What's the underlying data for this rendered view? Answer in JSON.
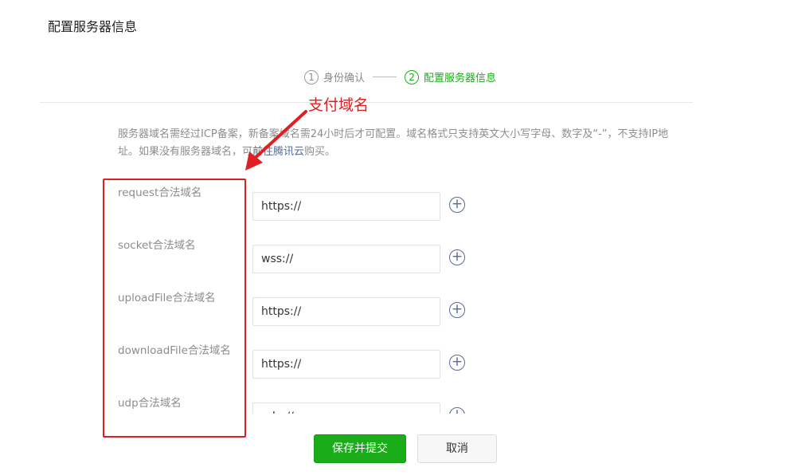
{
  "page": {
    "title": "配置服务器信息"
  },
  "steps": [
    {
      "num": "1",
      "label": "身份确认",
      "active": false
    },
    {
      "num": "2",
      "label": "配置服务器信息",
      "active": true
    }
  ],
  "annotation": {
    "text": "支付域名",
    "color": "#e02020"
  },
  "description": {
    "text_before": "服务器域名需经过ICP备案，新备案域名需24小时后才可配置。域名格式只支持英文大小写字母、数字及“-”，不支持IP地址。如果没有服务器域名，可",
    "link_text": "前往腾讯云",
    "text_after": "购买。"
  },
  "form": {
    "rows": [
      {
        "label": "request合法域名",
        "value": "https://"
      },
      {
        "label": "socket合法域名",
        "value": "wss://"
      },
      {
        "label": "uploadFile合法域名",
        "value": "https://"
      },
      {
        "label": "downloadFile合法域名",
        "value": "https://"
      },
      {
        "label": "udp合法域名",
        "value": "udp://"
      }
    ],
    "add_icon": "plus-circle-icon"
  },
  "buttons": {
    "submit": "保存并提交",
    "cancel": "取消"
  },
  "colors": {
    "primary": "#1aad19",
    "link": "#576b95",
    "annotation": "#e02020"
  }
}
